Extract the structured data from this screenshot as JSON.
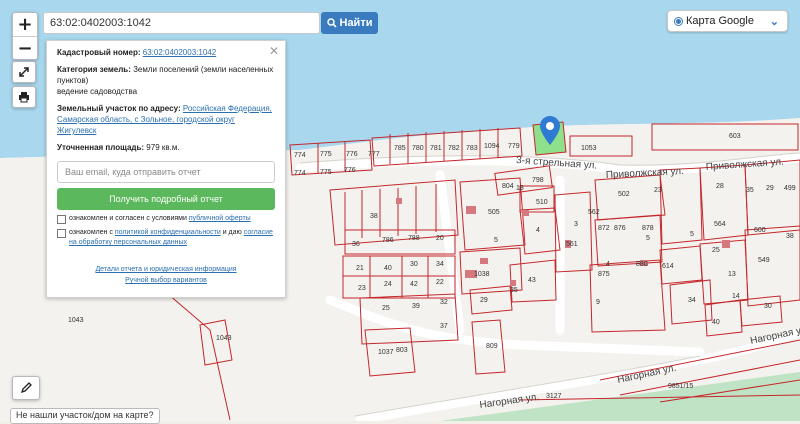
{
  "search": {
    "value": "63:02:0402003:1042",
    "button_label": "Найти"
  },
  "zoom": {
    "in": "+",
    "out": "−"
  },
  "layer": {
    "selected": "Карта Google"
  },
  "panel": {
    "cadastral_label": "Кадастровый номер:",
    "cadastral_value": "63:02:0402003:1042",
    "category_label": "Категория земель:",
    "category_value": "Земли поселений (земли населенных пунктов)",
    "use_value": "ведение садоводства",
    "address_label": "Земельный участок по адресу:",
    "address_value": "Российская Федерация, Самарская область, с Зольное, городской округ Жигулевск",
    "area_label": "Уточненная площадь:",
    "area_value": "979 кв.м.",
    "email_placeholder": "Ваш email, куда отправить отчет",
    "report_button": "Получить подробный отчет",
    "consent1_text": "ознакомлен и согласен с условиями",
    "consent1_link": "публичной оферты",
    "consent2_text": "ознакомлен с",
    "consent2_link": "политикой конфиденциальности",
    "consent2_tail": "и даю",
    "consent2_link2": "согласие на обработку персональных данных",
    "details_link": "Детали отчета и юридическая информация",
    "manual_link": "Ручной выбор вариантов"
  },
  "not_found": "Не нашли участок/дом на карте?",
  "map_labels": {
    "streets": [
      "3-я стрельная ул.",
      "Приволжская ул.",
      "Приволжская ул.",
      "Нагорная ул.",
      "Нагорная ул.",
      "Нагорная ул."
    ],
    "parcels": [
      "603",
      "1053",
      "774",
      "775",
      "776",
      "777",
      "785",
      "780",
      "781",
      "782",
      "783",
      "1094",
      "779",
      "774",
      "775",
      "776",
      "804",
      "798",
      "505",
      "510",
      "502",
      "23",
      "28",
      "35",
      "29",
      "499",
      "4",
      "36",
      "786",
      "788",
      "20",
      "5",
      "3",
      "872",
      "876",
      "878",
      "5",
      "564",
      "600",
      "38",
      "21",
      "40",
      "30",
      "34",
      "1038",
      "43",
      "4",
      "875",
      "880",
      "614",
      "25",
      "549",
      "23",
      "24",
      "42",
      "22",
      "9",
      "29",
      "35",
      "13",
      "14",
      "25",
      "39",
      "32",
      "37",
      "34",
      "40",
      "30",
      "1043",
      "1043",
      "1037",
      "803",
      "809",
      "9851/15",
      "3127",
      "5",
      "561",
      "562",
      "18",
      "38"
    ]
  }
}
